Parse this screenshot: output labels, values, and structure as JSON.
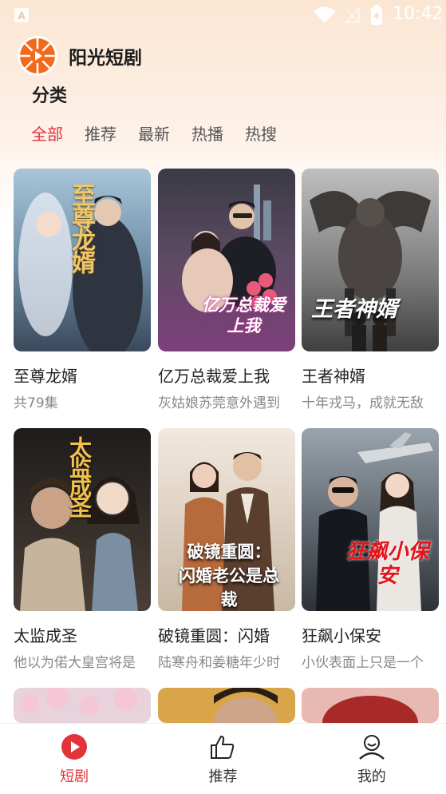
{
  "status_bar": {
    "time": "10:42"
  },
  "app": {
    "name": "阳光短剧"
  },
  "section": {
    "title": "分类"
  },
  "tabs": [
    {
      "label": "全部",
      "active": true
    },
    {
      "label": "推荐"
    },
    {
      "label": "最新"
    },
    {
      "label": "热播"
    },
    {
      "label": "热搜"
    }
  ],
  "dramas": [
    {
      "title": "至尊龙婿",
      "subtitle": "共79集",
      "poster_text": "至尊龙婿"
    },
    {
      "title": "亿万总裁爱上我",
      "subtitle": "灰姑娘苏莞意外遇到",
      "poster_text": "亿万总裁爱上我"
    },
    {
      "title": "王者神婿",
      "subtitle": "十年戎马，成就无敌",
      "poster_text": "王者神婿"
    },
    {
      "title": "太监成圣",
      "subtitle": "他以为偌大皇宫将是",
      "poster_text": "太监成圣"
    },
    {
      "title": "破镜重圆：闪婚",
      "subtitle": "陆寒舟和姜糖年少时",
      "poster_text": "破镜重圆：闪婚老公是总裁"
    },
    {
      "title": "狂飙小保安",
      "subtitle": "小伙表面上只是一个",
      "poster_text": "狂飙小保安"
    }
  ],
  "bottom_nav": [
    {
      "label": "短剧",
      "active": true,
      "icon": "play-circle-icon"
    },
    {
      "label": "推荐",
      "icon": "thumbs-up-icon"
    },
    {
      "label": "我的",
      "icon": "user-icon"
    }
  ],
  "colors": {
    "accent": "#e2333a",
    "brand": "#f26b1d"
  }
}
